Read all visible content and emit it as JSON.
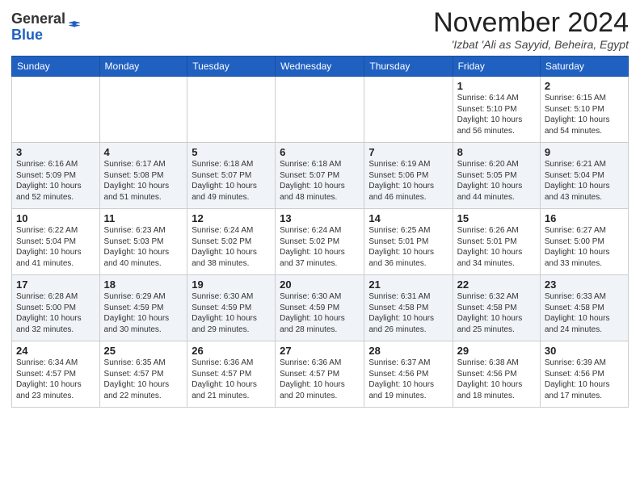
{
  "header": {
    "logo": {
      "line1": "General",
      "line2": "Blue"
    },
    "title": "November 2024",
    "location": "'Izbat 'Ali as Sayyid, Beheira, Egypt"
  },
  "calendar": {
    "headers": [
      "Sunday",
      "Monday",
      "Tuesday",
      "Wednesday",
      "Thursday",
      "Friday",
      "Saturday"
    ],
    "weeks": [
      [
        {
          "day": "",
          "info": ""
        },
        {
          "day": "",
          "info": ""
        },
        {
          "day": "",
          "info": ""
        },
        {
          "day": "",
          "info": ""
        },
        {
          "day": "",
          "info": ""
        },
        {
          "day": "1",
          "info": "Sunrise: 6:14 AM\nSunset: 5:10 PM\nDaylight: 10 hours\nand 56 minutes."
        },
        {
          "day": "2",
          "info": "Sunrise: 6:15 AM\nSunset: 5:10 PM\nDaylight: 10 hours\nand 54 minutes."
        }
      ],
      [
        {
          "day": "3",
          "info": "Sunrise: 6:16 AM\nSunset: 5:09 PM\nDaylight: 10 hours\nand 52 minutes."
        },
        {
          "day": "4",
          "info": "Sunrise: 6:17 AM\nSunset: 5:08 PM\nDaylight: 10 hours\nand 51 minutes."
        },
        {
          "day": "5",
          "info": "Sunrise: 6:18 AM\nSunset: 5:07 PM\nDaylight: 10 hours\nand 49 minutes."
        },
        {
          "day": "6",
          "info": "Sunrise: 6:18 AM\nSunset: 5:07 PM\nDaylight: 10 hours\nand 48 minutes."
        },
        {
          "day": "7",
          "info": "Sunrise: 6:19 AM\nSunset: 5:06 PM\nDaylight: 10 hours\nand 46 minutes."
        },
        {
          "day": "8",
          "info": "Sunrise: 6:20 AM\nSunset: 5:05 PM\nDaylight: 10 hours\nand 44 minutes."
        },
        {
          "day": "9",
          "info": "Sunrise: 6:21 AM\nSunset: 5:04 PM\nDaylight: 10 hours\nand 43 minutes."
        }
      ],
      [
        {
          "day": "10",
          "info": "Sunrise: 6:22 AM\nSunset: 5:04 PM\nDaylight: 10 hours\nand 41 minutes."
        },
        {
          "day": "11",
          "info": "Sunrise: 6:23 AM\nSunset: 5:03 PM\nDaylight: 10 hours\nand 40 minutes."
        },
        {
          "day": "12",
          "info": "Sunrise: 6:24 AM\nSunset: 5:02 PM\nDaylight: 10 hours\nand 38 minutes."
        },
        {
          "day": "13",
          "info": "Sunrise: 6:24 AM\nSunset: 5:02 PM\nDaylight: 10 hours\nand 37 minutes."
        },
        {
          "day": "14",
          "info": "Sunrise: 6:25 AM\nSunset: 5:01 PM\nDaylight: 10 hours\nand 36 minutes."
        },
        {
          "day": "15",
          "info": "Sunrise: 6:26 AM\nSunset: 5:01 PM\nDaylight: 10 hours\nand 34 minutes."
        },
        {
          "day": "16",
          "info": "Sunrise: 6:27 AM\nSunset: 5:00 PM\nDaylight: 10 hours\nand 33 minutes."
        }
      ],
      [
        {
          "day": "17",
          "info": "Sunrise: 6:28 AM\nSunset: 5:00 PM\nDaylight: 10 hours\nand 32 minutes."
        },
        {
          "day": "18",
          "info": "Sunrise: 6:29 AM\nSunset: 4:59 PM\nDaylight: 10 hours\nand 30 minutes."
        },
        {
          "day": "19",
          "info": "Sunrise: 6:30 AM\nSunset: 4:59 PM\nDaylight: 10 hours\nand 29 minutes."
        },
        {
          "day": "20",
          "info": "Sunrise: 6:30 AM\nSunset: 4:59 PM\nDaylight: 10 hours\nand 28 minutes."
        },
        {
          "day": "21",
          "info": "Sunrise: 6:31 AM\nSunset: 4:58 PM\nDaylight: 10 hours\nand 26 minutes."
        },
        {
          "day": "22",
          "info": "Sunrise: 6:32 AM\nSunset: 4:58 PM\nDaylight: 10 hours\nand 25 minutes."
        },
        {
          "day": "23",
          "info": "Sunrise: 6:33 AM\nSunset: 4:58 PM\nDaylight: 10 hours\nand 24 minutes."
        }
      ],
      [
        {
          "day": "24",
          "info": "Sunrise: 6:34 AM\nSunset: 4:57 PM\nDaylight: 10 hours\nand 23 minutes."
        },
        {
          "day": "25",
          "info": "Sunrise: 6:35 AM\nSunset: 4:57 PM\nDaylight: 10 hours\nand 22 minutes."
        },
        {
          "day": "26",
          "info": "Sunrise: 6:36 AM\nSunset: 4:57 PM\nDaylight: 10 hours\nand 21 minutes."
        },
        {
          "day": "27",
          "info": "Sunrise: 6:36 AM\nSunset: 4:57 PM\nDaylight: 10 hours\nand 20 minutes."
        },
        {
          "day": "28",
          "info": "Sunrise: 6:37 AM\nSunset: 4:56 PM\nDaylight: 10 hours\nand 19 minutes."
        },
        {
          "day": "29",
          "info": "Sunrise: 6:38 AM\nSunset: 4:56 PM\nDaylight: 10 hours\nand 18 minutes."
        },
        {
          "day": "30",
          "info": "Sunrise: 6:39 AM\nSunset: 4:56 PM\nDaylight: 10 hours\nand 17 minutes."
        }
      ]
    ]
  }
}
